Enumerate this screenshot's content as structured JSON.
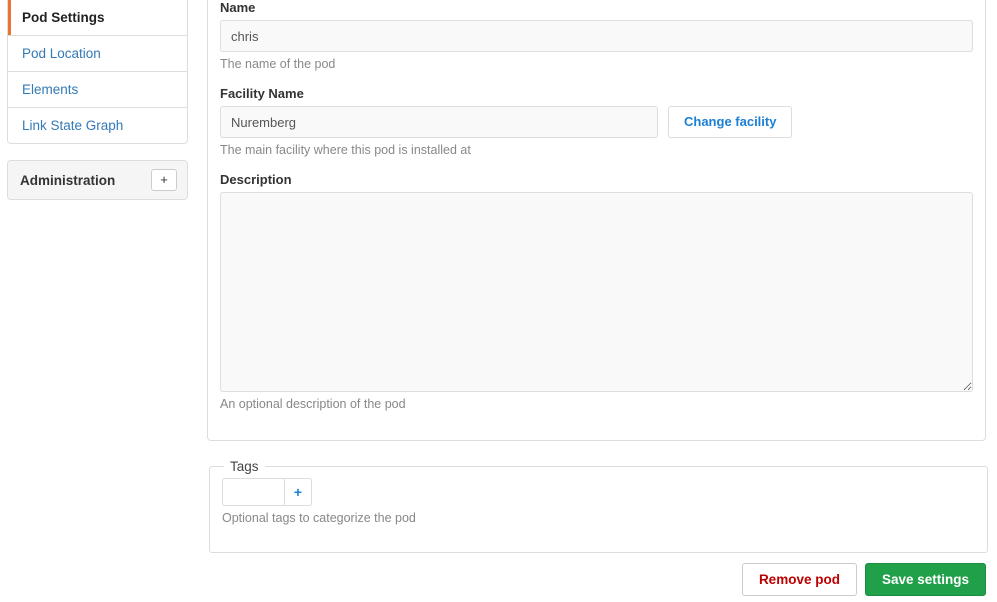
{
  "sidebar": {
    "nav_items": [
      {
        "label": "Pod Settings",
        "active": true
      },
      {
        "label": "Pod Location",
        "active": false
      },
      {
        "label": "Elements",
        "active": false
      },
      {
        "label": "Link State Graph",
        "active": false
      }
    ],
    "administration": {
      "title": "Administration",
      "toggle_label": "+",
      "toggle_icon": "plus-icon"
    }
  },
  "form": {
    "name": {
      "label": "Name",
      "value": "chris",
      "placeholder": "",
      "help": "The name of the pod"
    },
    "facility": {
      "label": "Facility Name",
      "value": "Nuremberg",
      "placeholder": "",
      "help": "The main facility where this pod is installed at",
      "change_button": "Change facility"
    },
    "description": {
      "label": "Description",
      "value": "",
      "placeholder": "",
      "help": "An optional description of the pod"
    }
  },
  "tags": {
    "legend": "Tags",
    "input_value": "",
    "input_placeholder": "",
    "add_button": "+",
    "add_icon": "plus-icon",
    "help": "Optional tags to categorize the pod"
  },
  "actions": {
    "remove_label": "Remove pod",
    "save_label": "Save settings"
  },
  "colors": {
    "active_marker": "#e8762c",
    "link": "#337ab7",
    "save_green": "#21a04a",
    "remove_red": "#bb0000",
    "panel_border": "#dddddd",
    "help_text": "#888888"
  }
}
